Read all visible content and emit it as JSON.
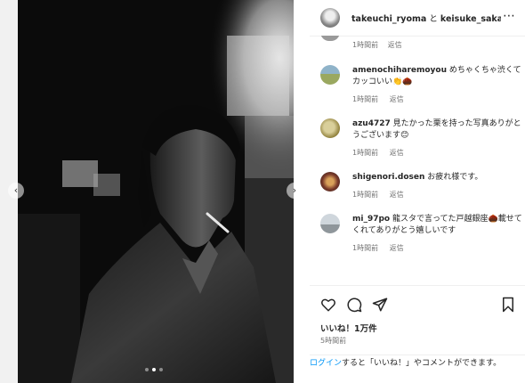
{
  "post": {
    "carousel": {
      "slide_count": 3,
      "active_index": 1
    }
  },
  "header": {
    "user1": "takeuchi_ryoma",
    "joiner": "と",
    "user2": "keisuke_sakai.st",
    "more_icon": "more-icon"
  },
  "top_partial": {
    "time": "1時間前",
    "reply": "返信"
  },
  "comments": [
    {
      "user": "amenochiharemoyou",
      "text": "めちゃくちゃ渋くてカッコいい👏🌰",
      "time": "1時間前",
      "reply": "返信"
    },
    {
      "user": "azu4727",
      "text": "見たかった栗を持った写真ありがとうございます😊",
      "time": "1時間前",
      "reply": "返信"
    },
    {
      "user": "shigenori.dosen",
      "text": "お疲れ様です。",
      "time": "1時間前",
      "reply": "返信"
    },
    {
      "user": "mi_97po",
      "text": "龍スタで言ってた戸越銀座🌰載せてくれてありがとう嬉しいです",
      "time": "1時間前",
      "reply": "返信"
    }
  ],
  "actions": {
    "icons": [
      "heart-icon",
      "comment-icon",
      "share-icon",
      "bookmark-icon"
    ],
    "likes": "いいね！1万件",
    "posted": "5時間前"
  },
  "login_prompt": {
    "link": "ログイン",
    "rest": "すると「いいね！」やコメントができます。"
  }
}
